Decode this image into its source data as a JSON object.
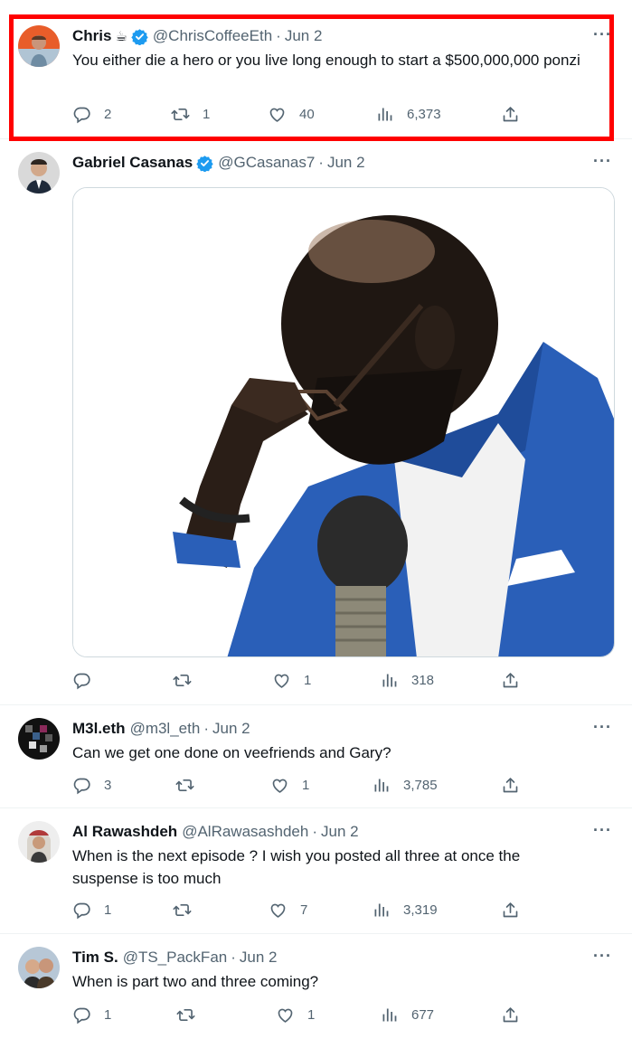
{
  "tweets": [
    {
      "name": "Chris",
      "emoji": "☕",
      "handle": "@ChrisCoffeeEth",
      "dot": "·",
      "date": "Jun 2",
      "text": "You either die a hero or you live long enough to start a $500,000,000 ponzi",
      "replies": "2",
      "retweets": "1",
      "likes": "40",
      "views": "6,373",
      "verified": true,
      "highlighted": true
    },
    {
      "name": "Gabriel Casanas",
      "handle": "@GCasanas7",
      "dot": "·",
      "date": "Jun 2",
      "text": "",
      "replies": "",
      "retweets": "",
      "likes": "1",
      "views": "318",
      "verified": true,
      "has_media": true
    },
    {
      "name": "M3l.eth",
      "handle": "@m3l_eth",
      "dot": "·",
      "date": "Jun 2",
      "text": "Can we get one done on veefriends and Gary?",
      "replies": "3",
      "retweets": "",
      "likes": "1",
      "views": "3,785"
    },
    {
      "name": "Al Rawashdeh",
      "handle": "@AlRawasashdeh",
      "dot": "·",
      "date": "Jun 2",
      "text": "When is the next episode ? I wish you posted all three at once the suspense is too much",
      "replies": "1",
      "retweets": "",
      "likes": "7",
      "views": "3,319"
    },
    {
      "name": "Tim S.",
      "handle": "@TS_PackFan",
      "dot": "·",
      "date": "Jun 2",
      "text": "When is part two and three coming?",
      "replies": "1",
      "retweets": "",
      "likes": "1",
      "views": "677"
    }
  ],
  "icons": {
    "reply": "reply-icon",
    "retweet": "retweet-icon",
    "like": "like-icon",
    "views": "views-icon",
    "share": "share-icon",
    "more": "more-icon",
    "verified": "verified-badge-icon"
  },
  "colors": {
    "text": "#0f1419",
    "muted": "#536471",
    "verified": "#1d9bf0",
    "highlight": "#ff0000",
    "divider": "#eff3f4"
  }
}
